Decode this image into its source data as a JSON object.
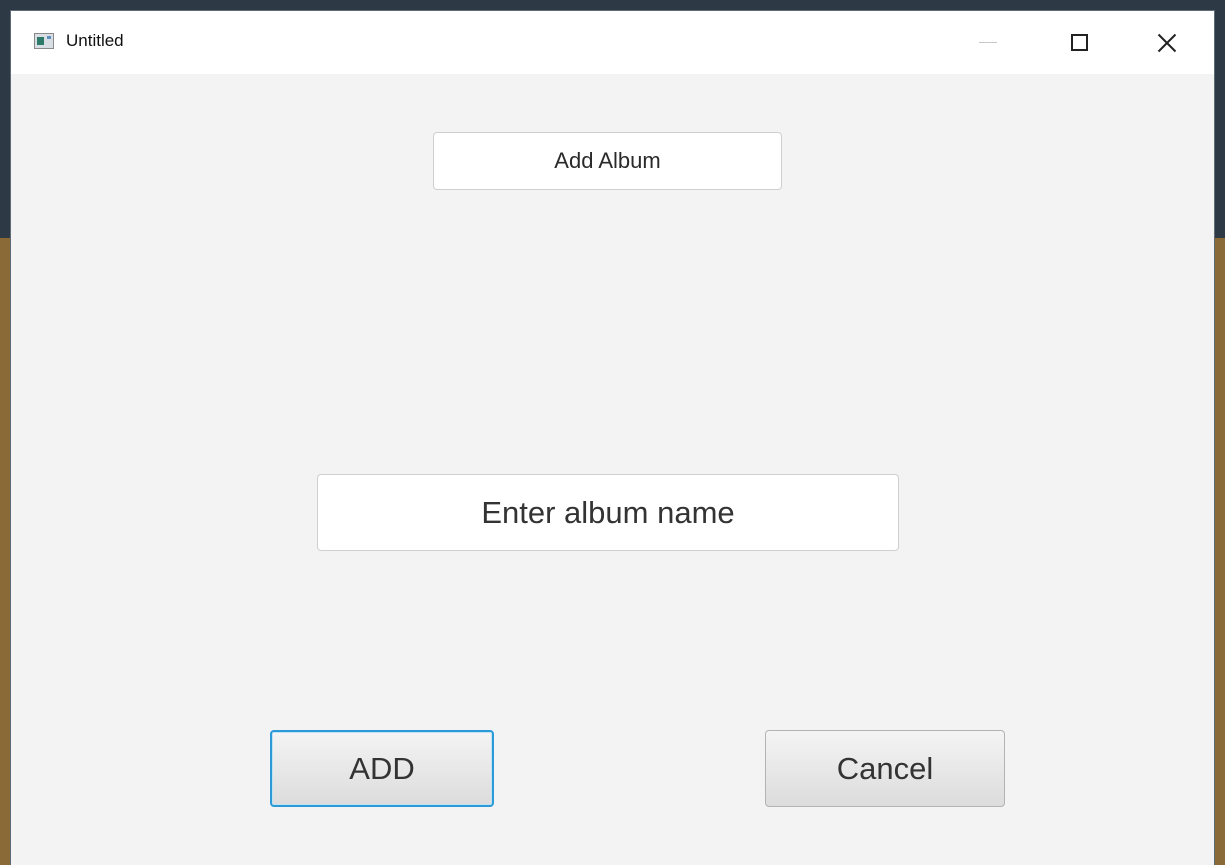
{
  "window": {
    "title": "Untitled",
    "icons": {
      "app": "app-window-icon",
      "minimize": "minimize-icon",
      "maximize": "maximize-icon",
      "close": "close-icon"
    }
  },
  "form": {
    "heading": "Add Album",
    "album_name_placeholder": "Enter album name",
    "album_name_value": "",
    "add_label": "ADD",
    "cancel_label": "Cancel"
  },
  "colors": {
    "focus_ring": "#2b9ad6",
    "window_bg": "#f3f3f3"
  }
}
